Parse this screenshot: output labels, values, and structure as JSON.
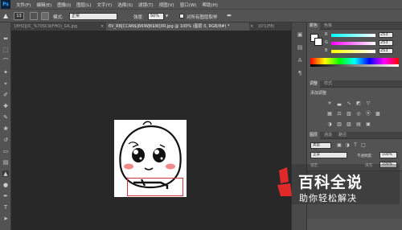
{
  "app": {
    "logo": "Ps"
  },
  "menu": [
    "文件(F)",
    "编辑(E)",
    "图像(I)",
    "图层(L)",
    "文字(Y)",
    "选择(S)",
    "滤镜(T)",
    "视图(V)",
    "窗口(W)",
    "帮助(H)"
  ],
  "options": {
    "brush_size": "13",
    "mode_label": "模式:",
    "mode_value": "正常",
    "strength_label": "强度:",
    "strength_value": "50%",
    "sample_all_label": "对所有图层取样"
  },
  "tabs": [
    {
      "label": "}8H2][IC_%70SC9(FHO)_GK.jpg",
      "active": false
    },
    {
      "label": "6V_R8[CCAN$]66IWJK$W]XR.jpg @ 100% (图层 0, RGB/8#) *",
      "active": true
    },
    {
      "label": ")O'1(F8)",
      "active": false
    }
  ],
  "color_panel": {
    "tabs": [
      "颜色",
      "色板"
    ],
    "r_label": "R",
    "r_value": "253",
    "g_label": "G",
    "g_value": "253",
    "b_label": "B",
    "b_value": "253"
  },
  "adjust_panel": {
    "tabs": [
      "调整",
      "样式"
    ],
    "title": "添加调整"
  },
  "layers_panel": {
    "tabs": [
      "图层",
      "通道",
      "路径"
    ],
    "kind": "类型",
    "blend": "正常",
    "opacity_label": "不透明度:",
    "opacity_value": "100%",
    "lock_label": "锁定:",
    "fill_label": "填充:",
    "fill_value": "100%"
  },
  "watermark": {
    "title": "百科全说",
    "subtitle": "助你轻松解决"
  },
  "colors": {
    "selection": "#d8343f",
    "accent_logo": "#e02a2a"
  }
}
